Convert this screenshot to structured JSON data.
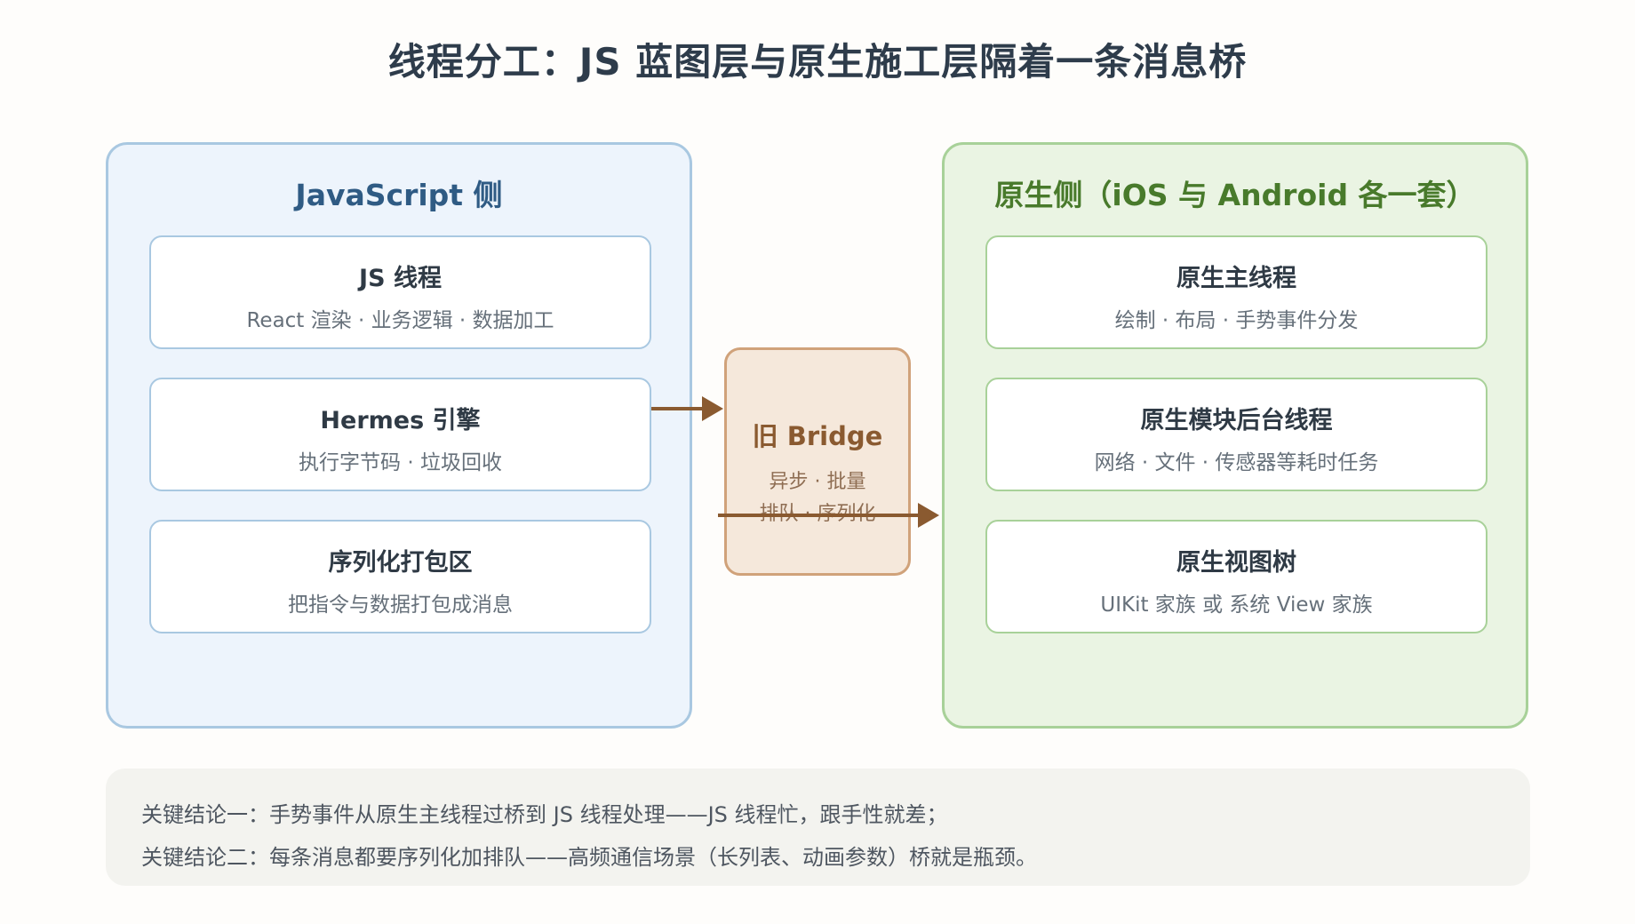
{
  "title": "线程分工：JS 蓝图层与原生施工层隔着一条消息桥",
  "js_panel": {
    "title": "JavaScript 侧",
    "cards": [
      {
        "title": "JS 线程",
        "subtitle": "React 渲染 · 业务逻辑 · 数据加工"
      },
      {
        "title": "Hermes 引擎",
        "subtitle": "执行字节码 · 垃圾回收"
      },
      {
        "title": "序列化打包区",
        "subtitle": "把指令与数据打包成消息"
      }
    ]
  },
  "bridge": {
    "title": "旧 Bridge",
    "line1": "异步 · 批量",
    "line2": "排队 · 序列化"
  },
  "native_panel": {
    "title": "原生侧（iOS 与 Android 各一套）",
    "cards": [
      {
        "title": "原生主线程",
        "subtitle": "绘制 · 布局 · 手势事件分发"
      },
      {
        "title": "原生模块后台线程",
        "subtitle": "网络 · 文件 · 传感器等耗时任务"
      },
      {
        "title": "原生视图树",
        "subtitle": "UIKit 家族 或 系统 View 家族"
      }
    ]
  },
  "footer": {
    "line1": "关键结论一：手势事件从原生主线程过桥到 JS 线程处理——JS 线程忙，跟手性就差；",
    "line2": "关键结论二：每条消息都要序列化加排队——高频通信场景（长列表、动画参数）桥就是瓶颈。"
  },
  "colors": {
    "js_accent": "#2f5b84",
    "native_accent": "#487a2b",
    "bridge_accent": "#8a5a30",
    "arrow": "#8a5a30"
  }
}
